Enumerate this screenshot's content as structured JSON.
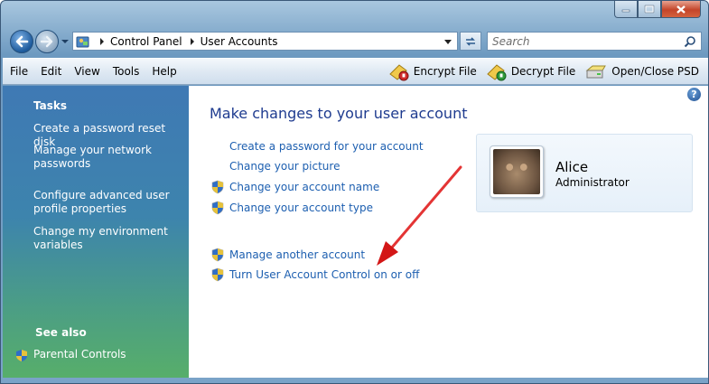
{
  "window": {
    "controls": [
      "minimize-icon",
      "maximize-icon",
      "close-icon"
    ]
  },
  "address_bar": {
    "breadcrumbs": [
      "Control Panel",
      "User Accounts"
    ]
  },
  "search": {
    "placeholder": "Search"
  },
  "menu": {
    "items": [
      "File",
      "Edit",
      "View",
      "Tools",
      "Help"
    ]
  },
  "toolbar": {
    "encrypt_label": "Encrypt File",
    "decrypt_label": "Decrypt File",
    "openclose_label": "Open/Close PSD"
  },
  "sidebar": {
    "tasks_header": "Tasks",
    "tasks": [
      "Create a password reset disk",
      "Manage your network passwords",
      "Configure advanced user profile properties",
      "Change my environment variables"
    ],
    "see_also_header": "See also",
    "see_also": [
      "Parental Controls"
    ]
  },
  "main": {
    "title": "Make changes to your user account",
    "actions": [
      "Create a password for your account",
      "Change your picture",
      "Change your account name",
      "Change your account type",
      "Manage another account",
      "Turn User Account Control on or off"
    ]
  },
  "user": {
    "name": "Alice",
    "role": "Administrator"
  },
  "colors": {
    "link": "#1d5fb0",
    "title": "#1e3b8f",
    "annotation_arrow": "#e01b1b"
  }
}
